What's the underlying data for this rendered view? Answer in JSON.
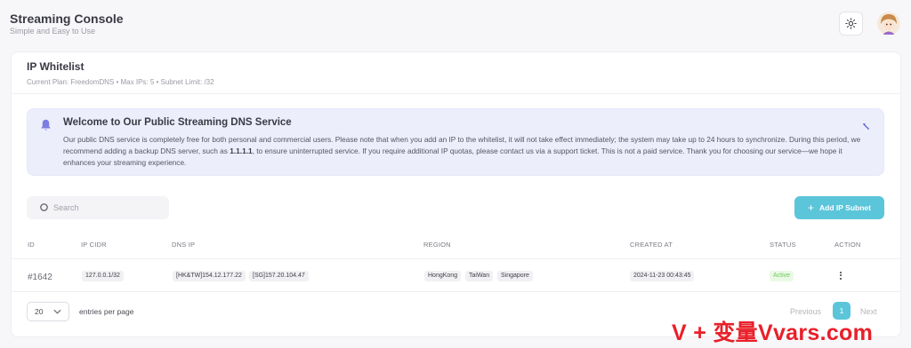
{
  "app": {
    "title": "Streaming Console",
    "subtitle": "Simple and Easy to Use"
  },
  "header": {
    "theme_icon": "sun-icon",
    "avatar_icon": "user-avatar"
  },
  "page": {
    "title": "IP Whitelist",
    "subtitle": "Current Plan: FreedomDNS • Max IPs: 5 • Subnet Limit: /32"
  },
  "alert": {
    "icon": "bell-icon",
    "title": "Welcome to Our Public Streaming DNS Service",
    "body_1": "Our public DNS service is completely free for both personal and commercial users. Please note that when you add an IP to the whitelist, it will not take effect immediately; the system may take up to 24 hours to synchronize. During this period, we recommend adding a backup DNS server, such as ",
    "body_dns": "1.1.1.1",
    "body_2": ", to ensure uninterrupted service. If you require additional IP quotas, please contact us via a support ticket. This is not a paid service. Thank you for choosing our service—we hope it enhances your streaming experience.",
    "close_icon": "collapse-icon"
  },
  "toolbar": {
    "search_placeholder": "Search",
    "add_label": "Add IP Subnet"
  },
  "table": {
    "columns": [
      "ID",
      "IP CIDR",
      "DNS IP",
      "REGION",
      "CREATED AT",
      "STATUS",
      "ACTION"
    ],
    "rows": [
      {
        "id": "#1642",
        "ip_cidr": "127.0.0.1/32",
        "dns_ip": [
          "[HK&TW]154.12.177.22",
          "[SG]157.20.104.47"
        ],
        "region": [
          "HongKong",
          "TaiWan",
          "Singapore"
        ],
        "created_at": "2024-11-23 00:43:45",
        "status": "Active"
      }
    ]
  },
  "footer": {
    "per_page_value": "20",
    "per_page_label": "entries per page",
    "prev": "Previous",
    "page": "1",
    "next": "Next"
  },
  "watermark": "V + 变量Vvars.com",
  "colors": {
    "accent": "#5bc5da",
    "alert_bg": "#eceefc",
    "active": "#6dc95a",
    "watermark": "#e8202a"
  }
}
